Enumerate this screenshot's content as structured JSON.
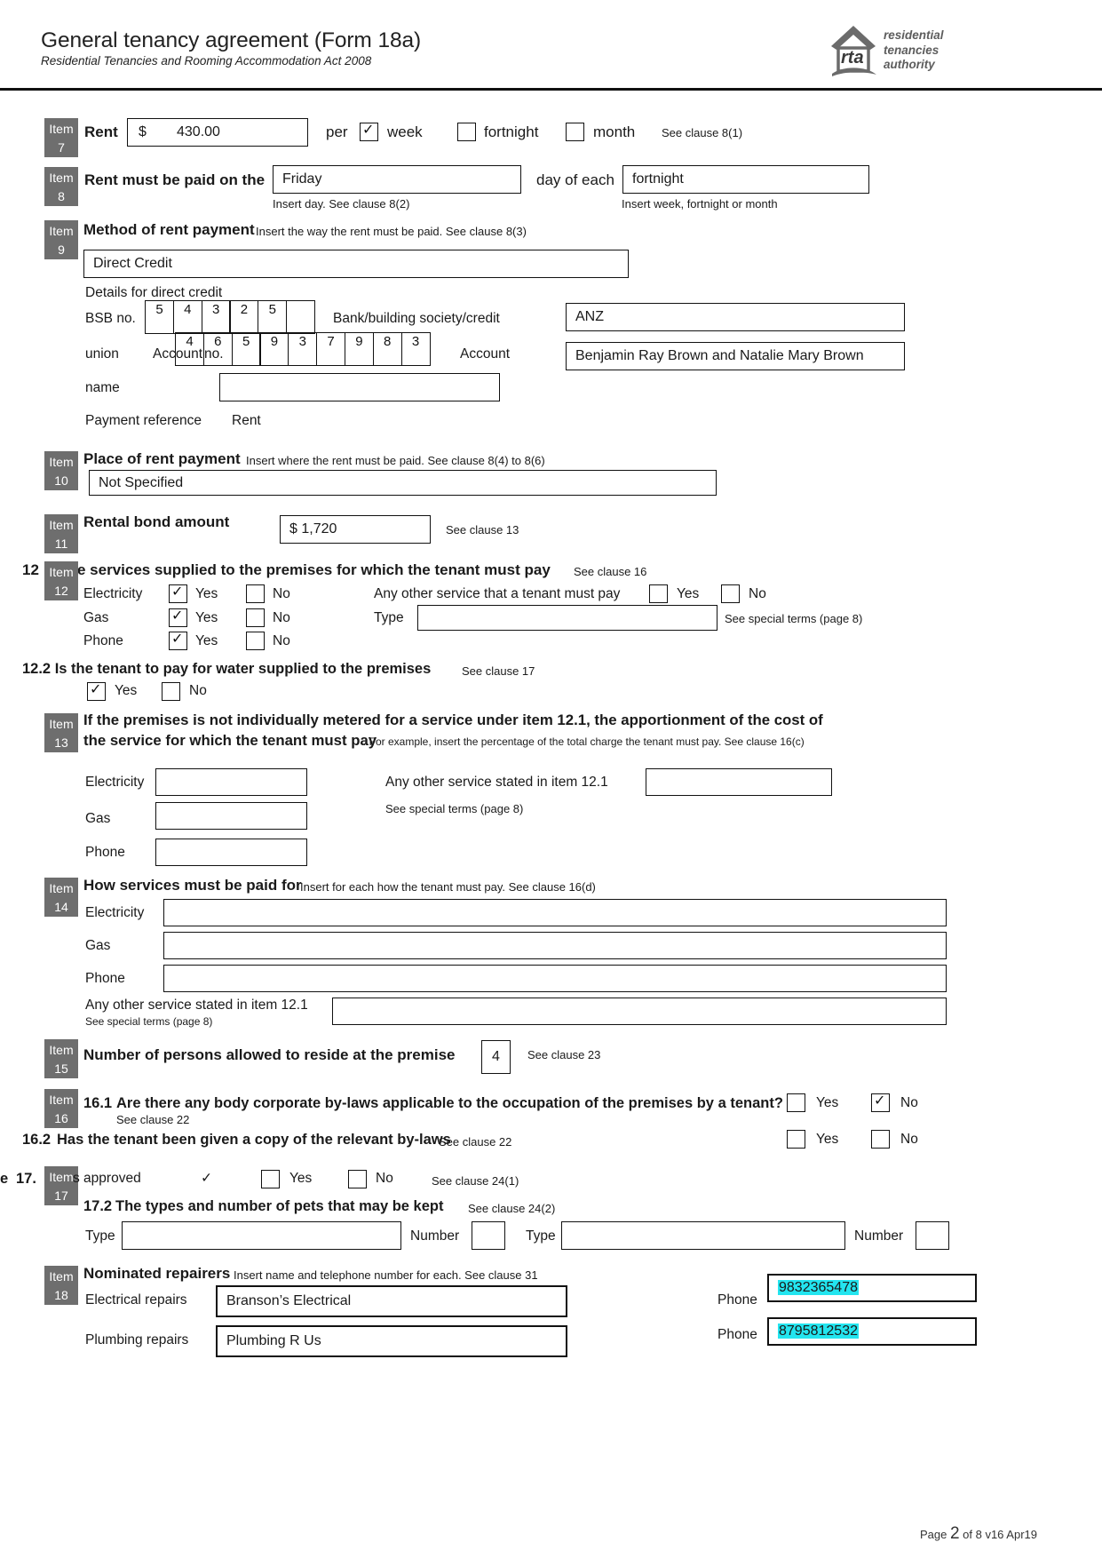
{
  "header": {
    "title": "General tenancy agreement (Form  18a)",
    "subtitle": "Residential Tenancies and Rooming Accommodation Act 2008",
    "logo_mark": "rta",
    "logo_line1": "residential",
    "logo_line2": "tenancies",
    "logo_line3": "authority"
  },
  "item7": {
    "badge_word": "Item",
    "badge_num": "7",
    "label": "Rent",
    "currency": "$",
    "amount": "430.00",
    "per": "per",
    "week": "week",
    "week_checked": true,
    "fortnight": "fortnight",
    "fortnight_checked": false,
    "month": "month",
    "month_checked": false,
    "clause": "See clause 8(1)"
  },
  "item8": {
    "badge_word": "Item",
    "badge_num": "8",
    "label": "Rent must be paid on the",
    "day_value": "Friday",
    "mid_label": "day of each",
    "period_value": "fortnight",
    "hint_left": "Insert day. See clause 8(2)",
    "hint_right": "Insert week, fortnight or month"
  },
  "item9": {
    "badge_word": "Item",
    "badge_num": "9",
    "label": "Method of rent payment",
    "hint": "Insert the way the rent must be paid. See clause 8(3)",
    "method_value": "Direct Credit",
    "details_label": "Details for direct credit",
    "bsb_label": "BSB no.",
    "bsb_digits": [
      "5",
      "4",
      "3",
      "2",
      "5",
      ""
    ],
    "bank_label_line1": "Bank/building society/credit",
    "bank_label_line2": "union",
    "bank_value": "ANZ",
    "account_no_label_a": "Account",
    "account_no_label_b": "no.",
    "account_digits": [
      "4",
      "6",
      "5",
      "9",
      "3",
      "7",
      "9",
      "8",
      "3"
    ],
    "account_name_label_a": "Account",
    "account_name_label_b": "name",
    "account_name_value": "Benjamin Ray Brown and Natalie Mary Brown",
    "extra_box_value": "",
    "payment_ref_label": "Payment reference",
    "payment_ref_value": "Rent"
  },
  "item10": {
    "badge_word": "Item",
    "badge_num": "10",
    "label": "Place of rent payment",
    "hint": "Insert where the rent must be paid. See clause 8(4) to 8(6)",
    "value": "Not Specified"
  },
  "item11": {
    "badge_word": "Item",
    "badge_num": "11",
    "label": "Rental bond amount",
    "value": "$ 1,720",
    "clause": "See clause 13"
  },
  "item12": {
    "badge_word": "Item",
    "badge_num": "12",
    "heading_prefix": "12",
    "heading": "e services supplied to the premises for which the tenant must pay",
    "clause": "See clause 16",
    "rows": [
      {
        "label": "Electricity",
        "yes": "Yes",
        "no": "No",
        "yes_checked": true,
        "no_checked": false
      },
      {
        "label": "Gas",
        "yes": "Yes",
        "no": "No",
        "yes_checked": true,
        "no_checked": false
      },
      {
        "label": "Phone",
        "yes": "Yes",
        "no": "No",
        "yes_checked": true,
        "no_checked": false
      }
    ],
    "other_label": "Any other service that a tenant must pay",
    "other_yes": "Yes",
    "other_no": "No",
    "other_yes_checked": false,
    "other_no_checked": false,
    "type_label": "Type",
    "type_value": "",
    "special_terms": "See special terms (page 8)",
    "q122": "12.2 Is the tenant to pay for water supplied to the premises",
    "q122_clause": "See clause 17",
    "q122_yes": "Yes",
    "q122_no": "No",
    "q122_yes_checked": true,
    "q122_no_checked": false
  },
  "item13": {
    "badge_word": "Item",
    "badge_num": "13",
    "heading_line1": "If the premises is not individually metered for a service under item 12.1, the apportionment of the cost of",
    "heading_line2": "the service for which the tenant must pay",
    "heading_note": ". For example, insert the percentage of the total charge the tenant must pay. See clause 16(c)",
    "electricity_label": "Electricity",
    "electricity_value": "",
    "gas_label": "Gas",
    "gas_value": "",
    "phone_label": "Phone",
    "phone_value": "",
    "other_label": "Any other service stated in item 12.1",
    "other_value": "",
    "special_terms": "See special terms (page 8)"
  },
  "item14": {
    "badge_word": "Item",
    "badge_num": "14",
    "label": "How services must be paid for",
    "hint": "Insert for each how the tenant must pay. See clause 16(d)",
    "electricity_label": "Electricity",
    "electricity_value": "",
    "gas_label": "Gas",
    "gas_value": "",
    "phone_label": "Phone",
    "phone_value": "",
    "other_label": "Any other service stated in item 12.1",
    "other_note": "See special terms (page 8)",
    "other_value": ""
  },
  "item15": {
    "badge_word": "Item",
    "badge_num": "15",
    "label": "Number of persons allowed to reside at the premise",
    "value": "4",
    "clause": "See clause 23"
  },
  "item16": {
    "badge_word": "Item",
    "badge_num": "16",
    "q161_num": "16.1",
    "q161": "Are there any body corporate by-laws applicable to the occupation of the premises by a tenant?",
    "q161_clause": "See clause 22",
    "q161_yes": "Yes",
    "q161_no": "No",
    "q161_yes_checked": false,
    "q161_no_checked": true,
    "q162_num": "16.2",
    "q162": "Has the tenant been given a copy of the relevant by-laws",
    "q162_clause": "See clause 22",
    "q162_yes": "Yes",
    "q162_no": "No",
    "q162_yes_checked": false,
    "q162_no_checked": false
  },
  "item17": {
    "badge_word": "Item",
    "badge_num": "17",
    "q171_pre": "e",
    "q171_num": "17.",
    "q171_text": "s  approved",
    "q171_tick": "✓",
    "q171_yes": "Yes",
    "q171_no": "No",
    "q171_yes_checked": false,
    "q171_no_checked": false,
    "q171_clause": "See clause 24(1)",
    "q172_num": "17.2",
    "q172": "The types and number of pets that may be kept",
    "q172_clause": "See clause 24(2)",
    "type1_label": "Type",
    "type1_value": "",
    "number1_label": "Number",
    "number1_value": "",
    "type2_label": "Type",
    "type2_value": "",
    "number2_label": "Number",
    "number2_value": ""
  },
  "item18": {
    "badge_word": "Item",
    "badge_num": "18",
    "label": "Nominated repairers",
    "hint": "Insert name and telephone number for each. See clause 31",
    "electrical_label": "Electrical repairs",
    "electrical_value": "Branson’s Electrical",
    "electrical_phone_label": "Phone",
    "electrical_phone": "9832365478",
    "plumbing_label": "Plumbing repairs",
    "plumbing_value": "Plumbing R Us",
    "plumbing_phone_label": "Phone",
    "plumbing_phone": "8795812532",
    "highlight_color": "#23e5ef"
  },
  "footer": {
    "prefix": "Page ",
    "page": "2",
    "suffix": " of 8 v16 Apr19"
  }
}
